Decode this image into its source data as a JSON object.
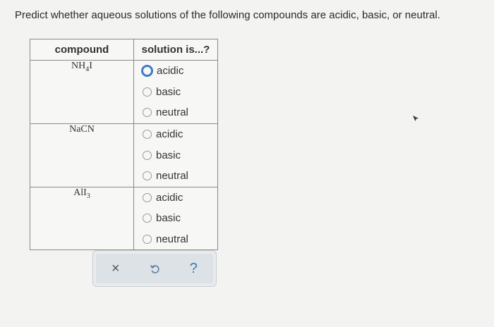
{
  "prompt": "Predict whether aqueous solutions of the following compounds are acidic, basic, or neutral.",
  "table": {
    "headers": [
      "compound",
      "solution is...?"
    ],
    "rows": [
      {
        "compound": {
          "main": "NH",
          "sub": "4",
          "tail": "I"
        },
        "options": [
          "acidic",
          "basic",
          "neutral"
        ]
      },
      {
        "compound": {
          "main": "NaCN",
          "sub": "",
          "tail": ""
        },
        "options": [
          "acidic",
          "basic",
          "neutral"
        ]
      },
      {
        "compound": {
          "main": "AlI",
          "sub": "3",
          "tail": ""
        },
        "options": [
          "acidic",
          "basic",
          "neutral"
        ]
      }
    ]
  },
  "toolbar": {
    "close_symbol": "×",
    "undo_symbol": "↺",
    "help_symbol": "?"
  },
  "icons": [
    "radio-button",
    "close-icon",
    "undo-icon",
    "help-icon",
    "mouse-cursor-icon"
  ],
  "colors": {
    "focus_ring": "#3d7cc9",
    "help_accent": "#3e78c0"
  }
}
